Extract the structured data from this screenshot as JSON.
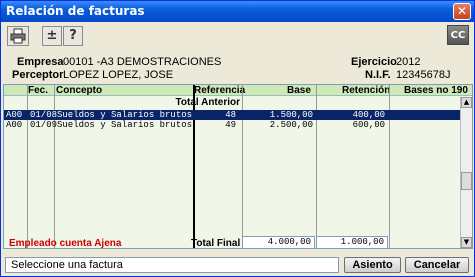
{
  "window": {
    "title": "Relación de facturas",
    "close_glyph": "✕"
  },
  "toolbar": {
    "print_icon": "printer-icon",
    "plusminus_label": "±",
    "help_label": "?",
    "cc_label": "CC"
  },
  "header": {
    "empresa_label": "Empresa",
    "empresa_value": "00101 -A3 DEMOSTRACIONES",
    "ejercicio_label": "Ejercicio",
    "ejercicio_value": "2012",
    "perceptor_label": "Perceptor",
    "perceptor_value": "LOPEZ LOPEZ, JOSE",
    "nif_label": "N.I.F.",
    "nif_value": "12345678J"
  },
  "grid": {
    "columns": [
      "Fec.",
      "Concepto",
      "Referencia",
      "Base",
      "Retención",
      "Bases no 190"
    ],
    "total_anterior_label": "Total Anterior",
    "rows": [
      {
        "code": "A00",
        "fec": "01/08",
        "concepto": "Sueldos y Salarios brutos",
        "referencia": "48",
        "base": "1.500,00",
        "retencion": "400,00",
        "bases190": "",
        "selected": true
      },
      {
        "code": "A00",
        "fec": "01/09",
        "concepto": "Sueldos y Salarios brutos",
        "referencia": "49",
        "base": "2.500,00",
        "retencion": "600,00",
        "bases190": "",
        "selected": false
      }
    ]
  },
  "footer": {
    "empleado_label": "Empleado cuenta Ajena",
    "empleado_color": "#cc0000",
    "total_final_label": "Total Final",
    "total_base": "4.000,00",
    "total_retencion": "1.000,00"
  },
  "status": {
    "text": "Seleccione una factura"
  },
  "buttons": {
    "asiento_label": "Asiento",
    "cancelar_label": "Cancelar"
  },
  "colors": {
    "title_bar": "#0a5ddb",
    "grid_bg": "#f0f7e8",
    "grid_header": "#cfe8b7",
    "selection": "#0a246a"
  }
}
